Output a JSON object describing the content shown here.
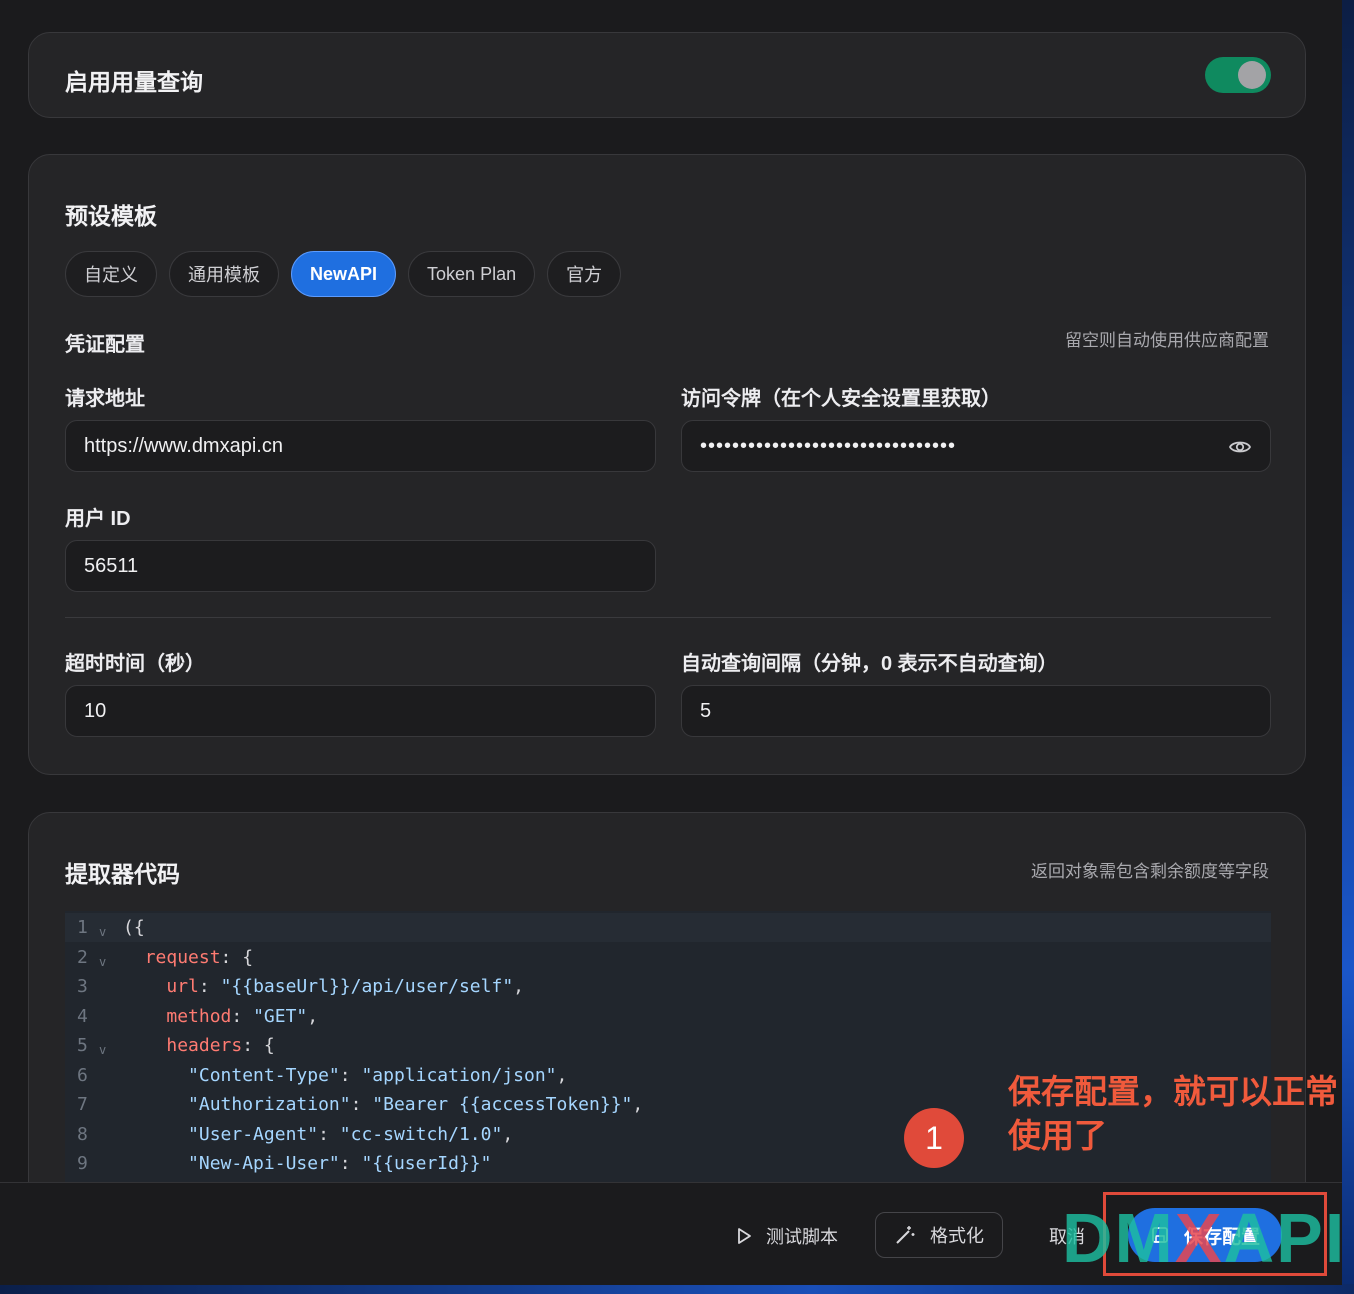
{
  "usage_card": {
    "title": "启用用量查询",
    "enabled": true
  },
  "preset_card": {
    "title": "预设模板",
    "tabs": [
      "自定义",
      "通用模板",
      "NewAPI",
      "Token Plan",
      "官方"
    ],
    "active_tab": "NewAPI",
    "credentials_label": "凭证配置",
    "credentials_hint": "留空则自动使用供应商配置",
    "request_url": {
      "label": "请求地址",
      "value": "https://www.dmxapi.cn"
    },
    "access_token": {
      "label": "访问令牌（在个人安全设置里获取）",
      "value": "••••••••••••••••••••••••••••••••"
    },
    "user_id": {
      "label": "用户 ID",
      "value": "56511"
    },
    "timeout": {
      "label": "超时时间（秒）",
      "value": "10"
    },
    "interval": {
      "label": "自动查询间隔（分钟，0 表示不自动查询）",
      "value": "5"
    }
  },
  "extractor_card": {
    "title": "提取器代码",
    "hint": "返回对象需包含剩余额度等字段",
    "lines": [
      {
        "n": "1",
        "fold": true,
        "indent": "",
        "key": "",
        "rest": "({"
      },
      {
        "n": "2",
        "fold": true,
        "indent": "  ",
        "key": "request",
        "rest": ": {"
      },
      {
        "n": "3",
        "fold": false,
        "indent": "    ",
        "key": "url",
        "str": "\"{{baseUrl}}/api/user/self\"",
        "rest": ","
      },
      {
        "n": "4",
        "fold": false,
        "indent": "    ",
        "key": "method",
        "str": "\"GET\"",
        "rest": ","
      },
      {
        "n": "5",
        "fold": true,
        "indent": "    ",
        "key": "headers",
        "rest": ": {"
      },
      {
        "n": "6",
        "fold": false,
        "indent": "      ",
        "qkey": "\"Content-Type\"",
        "str": "\"application/json\"",
        "rest": ","
      },
      {
        "n": "7",
        "fold": false,
        "indent": "      ",
        "qkey": "\"Authorization\"",
        "str": "\"Bearer {{accessToken}}\"",
        "rest": ","
      },
      {
        "n": "8",
        "fold": false,
        "indent": "      ",
        "qkey": "\"User-Agent\"",
        "str": "\"cc-switch/1.0\"",
        "rest": ","
      },
      {
        "n": "9",
        "fold": false,
        "indent": "      ",
        "qkey": "\"New-Api-User\"",
        "str": "\"{{userId}}\"",
        "rest": ""
      }
    ]
  },
  "footer": {
    "test_label": "测试脚本",
    "format_label": "格式化",
    "cancel_label": "取消",
    "save_label": "保存配置"
  },
  "annotation": {
    "step": "1",
    "text": "保存配置，就可以正常使用了"
  },
  "watermark": {
    "text": "DMXAPI"
  },
  "colors": {
    "accent": "#1f6fe0",
    "toggle_on": "#0f8a5f",
    "annotation": "#e04a3a"
  }
}
